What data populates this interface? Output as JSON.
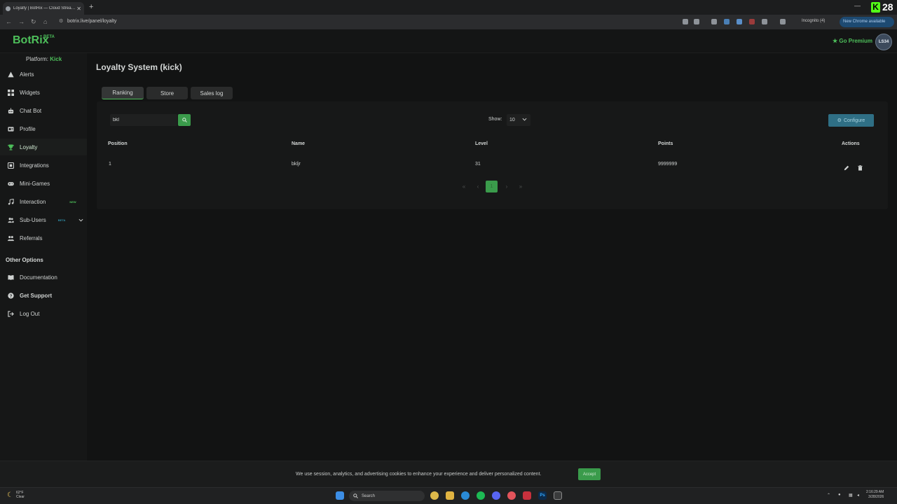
{
  "browser": {
    "tab_title": "Loyalty | BotRix — Cloud Strea…",
    "url": "botrix.live/panel/loyalty",
    "incognito_label": "Incognito (4)",
    "update_label": "New Chrome available",
    "overlay_number": "28"
  },
  "header": {
    "logo": "BotRix",
    "beta": "BETA",
    "premium_label": "Go Premium",
    "avatar_text": "LS34"
  },
  "sidebar": {
    "platform_label": "Platform:",
    "platform_value": "Kick",
    "items": [
      {
        "label": "Alerts"
      },
      {
        "label": "Widgets"
      },
      {
        "label": "Chat Bot"
      },
      {
        "label": "Profile"
      },
      {
        "label": "Loyalty"
      },
      {
        "label": "Integrations"
      },
      {
        "label": "Mini-Games"
      },
      {
        "label": "Interaction",
        "badge": "NEW"
      },
      {
        "label": "Sub-Users",
        "badge": "BETA"
      },
      {
        "label": "Referrals"
      }
    ],
    "other_options_label": "Other Options",
    "other_items": [
      {
        "label": "Documentation"
      },
      {
        "label": "Get Support"
      },
      {
        "label": "Log Out"
      }
    ]
  },
  "main": {
    "title": "Loyalty System (kick)",
    "tabs": [
      {
        "label": "Ranking"
      },
      {
        "label": "Store"
      },
      {
        "label": "Sales log"
      }
    ],
    "search_value": "bkl",
    "show_label": "Show:",
    "show_value": "10",
    "configure_label": "Configure",
    "columns": [
      "Position",
      "Name",
      "Level",
      "Points",
      "Actions"
    ],
    "rows": [
      {
        "position": "1",
        "name": "bkljr",
        "level": "31",
        "points": "9999999"
      }
    ],
    "pagination": {
      "first": "«",
      "prev": "‹",
      "current": "1",
      "next": "›",
      "last": "»"
    }
  },
  "cookie": {
    "text": "We use session, analytics, and advertising cookies to enhance your experience and deliver personalized content.",
    "accept_label": "Accept"
  },
  "taskbar": {
    "temp": "62°F",
    "condition": "Clear",
    "search_label": "Search",
    "time": "2:16:29 AM",
    "date": "3/28/2026"
  },
  "colors": {
    "accent": "#3a9b4b",
    "brand": "#4dbf5a",
    "configure": "#2f6f85"
  }
}
